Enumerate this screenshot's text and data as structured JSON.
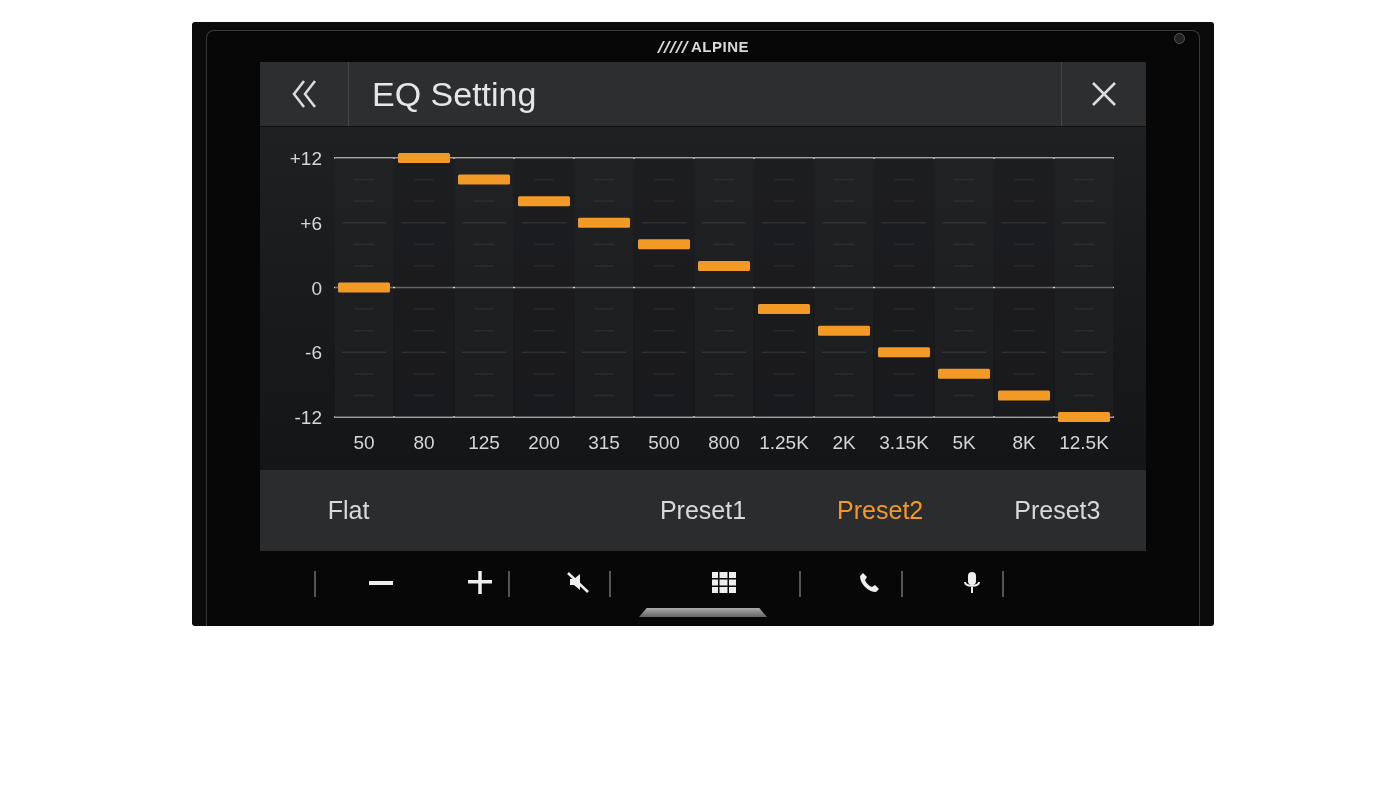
{
  "device": {
    "logo": "ALPINE"
  },
  "header": {
    "title": "EQ Setting"
  },
  "eq": {
    "scale_labels": [
      "+12",
      "+6",
      "0",
      "-6",
      "-12"
    ],
    "bands": [
      {
        "label": "50",
        "level": 0.5
      },
      {
        "label": "80",
        "level": 1
      },
      {
        "label": "125",
        "level": 0.917
      },
      {
        "label": "200",
        "level": 0.833
      },
      {
        "label": "315",
        "level": 0.75
      },
      {
        "label": "500",
        "level": 0.667
      },
      {
        "label": "800",
        "level": 0.583
      },
      {
        "label": "1.25K",
        "level": 0.417
      },
      {
        "label": "2K",
        "level": 0.333
      },
      {
        "label": "3.15K",
        "level": 0.25
      },
      {
        "label": "5K",
        "level": 0.167
      },
      {
        "label": "8K",
        "level": 0.083
      },
      {
        "label": "12.5K",
        "level": 0
      }
    ]
  },
  "presets": [
    {
      "label": "Flat",
      "selected": false
    },
    {
      "label": "Preset1",
      "selected": false
    },
    {
      "label": "Preset2",
      "selected": true
    },
    {
      "label": "Preset3",
      "selected": false
    }
  ]
}
